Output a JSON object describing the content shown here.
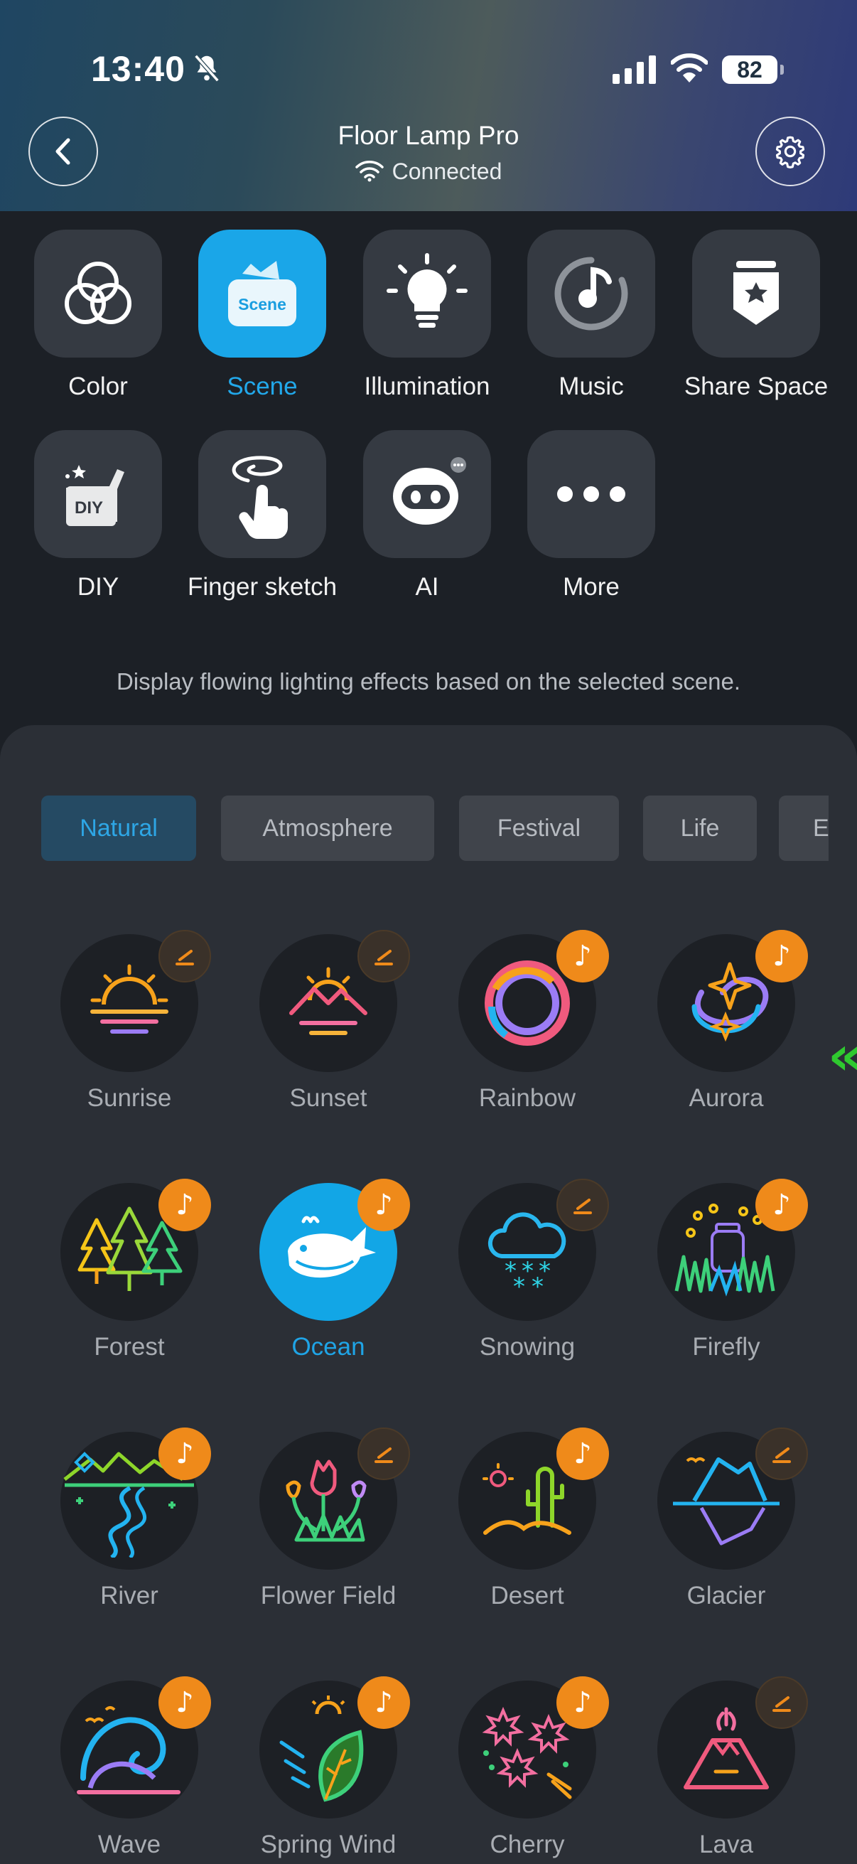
{
  "status": {
    "time": "13:40",
    "battery": "82"
  },
  "header": {
    "title": "Floor Lamp Pro",
    "connection": "Connected"
  },
  "features": [
    {
      "label": "Color",
      "icon": "color-rings-icon"
    },
    {
      "label": "Scene",
      "icon": "scene-icon",
      "icon_text": "Scene",
      "active": true
    },
    {
      "label": "Illumination",
      "icon": "bulb-icon"
    },
    {
      "label": "Music",
      "icon": "music-icon"
    },
    {
      "label": "Share Space",
      "icon": "share-space-icon"
    },
    {
      "label": "DIY",
      "icon": "diy-icon",
      "icon_text": "DIY"
    },
    {
      "label": "Finger sketch",
      "icon": "finger-sketch-icon"
    },
    {
      "label": "AI",
      "icon": "ai-robot-icon"
    },
    {
      "label": "More",
      "icon": "more-icon"
    }
  ],
  "description": "Display flowing lighting effects based on the selected scene.",
  "tabs": [
    {
      "label": "Natural",
      "active": true
    },
    {
      "label": "Atmosphere"
    },
    {
      "label": "Festival"
    },
    {
      "label": "Life"
    },
    {
      "label": "E"
    }
  ],
  "scenes": [
    {
      "label": "Sunrise",
      "badge": "edit",
      "icon": "sunrise-icon"
    },
    {
      "label": "Sunset",
      "badge": "edit",
      "icon": "sunset-icon"
    },
    {
      "label": "Rainbow",
      "badge": "music",
      "icon": "rainbow-icon"
    },
    {
      "label": "Aurora",
      "badge": "music",
      "icon": "aurora-icon"
    },
    {
      "label": "Forest",
      "badge": "music",
      "icon": "forest-icon"
    },
    {
      "label": "Ocean",
      "badge": "music",
      "icon": "whale-icon",
      "active": true
    },
    {
      "label": "Snowing",
      "badge": "edit",
      "icon": "snow-cloud-icon"
    },
    {
      "label": "Firefly",
      "badge": "music",
      "icon": "firefly-jar-icon"
    },
    {
      "label": "River",
      "badge": "music",
      "icon": "river-icon"
    },
    {
      "label": "Flower Field",
      "badge": "edit",
      "icon": "tulip-icon"
    },
    {
      "label": "Desert",
      "badge": "music",
      "icon": "cactus-icon"
    },
    {
      "label": "Glacier",
      "badge": "edit",
      "icon": "iceberg-icon"
    },
    {
      "label": "Wave",
      "badge": "music",
      "icon": "wave-icon"
    },
    {
      "label": "Spring Wind",
      "badge": "music",
      "icon": "leaf-icon"
    },
    {
      "label": "Cherry",
      "badge": "music",
      "icon": "cherry-blossom-icon"
    },
    {
      "label": "Lava",
      "badge": "edit",
      "icon": "volcano-icon"
    }
  ],
  "badge_glyph": "♪",
  "colors": {
    "accent": "#1aa6e8",
    "music_badge": "#ef8a1a",
    "panel": "#2b2f36",
    "background": "#1c2026",
    "side_arrow": "#2fc92f"
  }
}
